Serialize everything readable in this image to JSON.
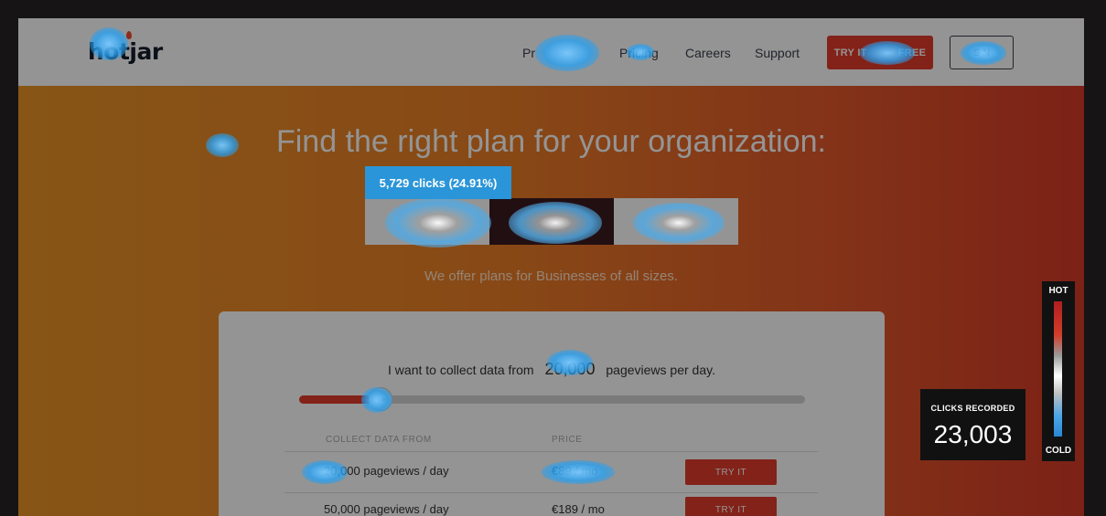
{
  "site": {
    "logo": "hotjar",
    "nav": [
      "Pr",
      "Pricing",
      "Careers",
      "Support"
    ],
    "try_button": "TRY IT",
    "try_button_end": "FREE",
    "signin_button": "S   N"
  },
  "hero": {
    "title": "Find the right plan for your organization:",
    "segments": [
      "",
      "",
      ""
    ],
    "subtitle": "We offer plans for Businesses of all sizes."
  },
  "pricing": {
    "collect_prefix": "I want to collect data from",
    "pageviews_value": "20,000",
    "collect_suffix": "pageviews per day.",
    "slider_handle": "◂ ▸",
    "slider_fraction": 0.16,
    "col_collect": "COLLECT DATA FROM",
    "col_price": "PRICE",
    "rows": [
      {
        "pageviews": "20,000 pageviews / day",
        "price": "€89 / mo",
        "cta": "TRY IT"
      },
      {
        "pageviews": "50,000 pageviews / day",
        "price": "€189 / mo",
        "cta": "TRY IT"
      }
    ]
  },
  "heatmap": {
    "tooltip": "5,729 clicks (24.91%)",
    "clicks_label": "CLICKS RECORDED",
    "clicks_value": "23,003",
    "legend_hot": "HOT",
    "legend_cold": "COLD"
  }
}
